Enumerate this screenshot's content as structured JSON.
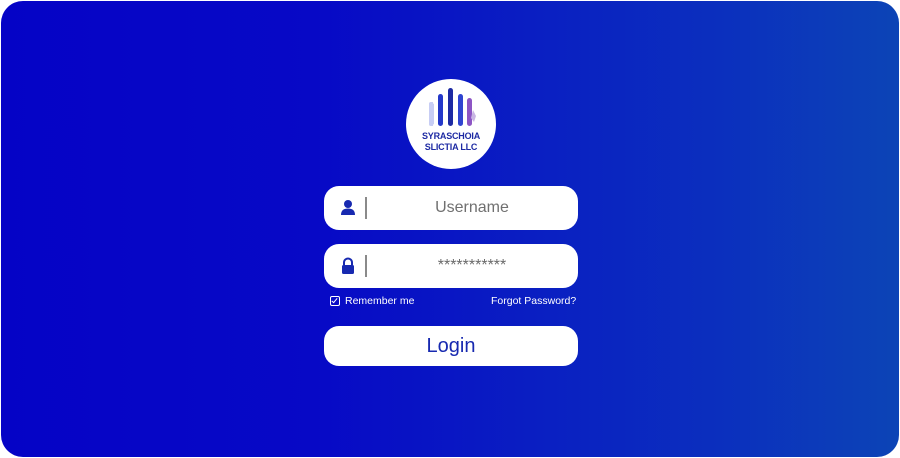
{
  "logo": {
    "line1": "SYRASCHOIA",
    "line2": "SLICTIA LLC"
  },
  "form": {
    "username": {
      "placeholder": "Username",
      "icon": "user-icon"
    },
    "password": {
      "value": "***********",
      "icon": "lock-icon"
    },
    "remember_label": "Remember me",
    "remember_checked": true,
    "forgot_label": "Forgot Password?",
    "login_label": "Login"
  },
  "colors": {
    "background_start": "#0503c6",
    "background_end": "#0c44b6",
    "accent_text": "#1729b0",
    "card": "#ffffff"
  }
}
